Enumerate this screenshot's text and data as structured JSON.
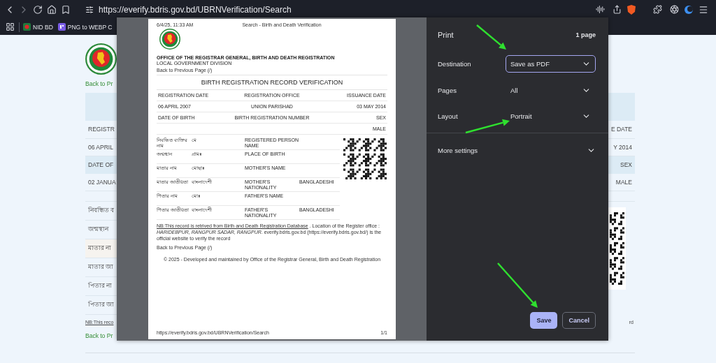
{
  "browser": {
    "url": "https://everify.bdris.gov.bd/UBRNVerification/Search",
    "bookmarks": [
      {
        "label": "NID BD",
        "kind": "nid"
      },
      {
        "label": "PNG to WEBP C",
        "kind": "png"
      }
    ]
  },
  "background_page": {
    "back_link": "Back to Pr",
    "table_rows": [
      {
        "kind": "band"
      },
      {
        "kind": "plain",
        "left": "REGISTR",
        "right": "E DATE"
      },
      {
        "kind": "plain",
        "left": "06 APRIL",
        "right": "Y 2014"
      },
      {
        "kind": "band",
        "left": "DATE OF",
        "right": "SEX"
      },
      {
        "kind": "plain",
        "left": "02 JANUA",
        "right": "MALE"
      }
    ],
    "person_rows": [
      {
        "kind": "plain",
        "label": "নিবন্ধিত ব"
      },
      {
        "kind": "plain",
        "label": "জন্মস্থান"
      },
      {
        "kind": "shade",
        "label": "মাতার না"
      },
      {
        "kind": "plain",
        "label": "মাতার জা"
      },
      {
        "kind": "plain",
        "label": "পিতার না"
      },
      {
        "kind": "plain",
        "label": "পিতার জা"
      }
    ],
    "note": "NB:This reco",
    "note_end": "rd",
    "bottom_back_link": "Back to Pr"
  },
  "print_preview": {
    "header_date": "6/4/25, 11:33 AM",
    "header_title": "Search - Birth and Death Verification",
    "office": "OFFICE OF THE REGISTRAR GENERAL, BIRTH AND DEATH REGISTRATION",
    "division": "LOCAL GOVERNMENT DIVISION",
    "back_link": "Back to Previous Page (/)",
    "title": "BIRTH REGISTRATION RECORD VERIFICATION",
    "info_rows": [
      {
        "left": "REGISTRATION DATE",
        "center": "REGISTRATION OFFICE",
        "right": "ISSUANCE DATE"
      },
      {
        "left": "06 APRIL 2007",
        "center": "UNION PARISHAD",
        "right": "03 MAY 2014"
      },
      {
        "left": "DATE OF BIRTH",
        "center": "BIRTH REGISTRATION NUMBER",
        "right": "SEX"
      },
      {
        "right": "MALE"
      }
    ],
    "person_rows": [
      {
        "bn_label": "নিবন্ধিত ব্যক্তির নাম",
        "bn_value": "মে",
        "en_label": "REGISTERED PERSON NAME"
      },
      {
        "bn_label": "জন্মস্থান",
        "bn_value": "গ্রামঃ",
        "en_label": "PLACE OF BIRTH"
      },
      {
        "bn_label": "মাতার নাম",
        "bn_value": "মোছাঃ",
        "en_label": "MOTHER'S NAME"
      },
      {
        "bn_label": "মাতার জাতীয়তা",
        "bn_value": "বাংলাদেশী",
        "en_label": "MOTHER'S NATIONALITY",
        "en_value": "BANGLADESHI"
      },
      {
        "bn_label": "পিতার নাম",
        "bn_value": "মোঃ",
        "en_label": "FATHER'S NAME"
      },
      {
        "bn_label": "পিতার জাতীয়তা",
        "bn_value": "বাংলাদেশী",
        "en_label": "FATHER'S NATIONALITY",
        "en_value": "BANGLADESHI"
      }
    ],
    "note_link": "NB:This record is retrived from Birth and Death Registration Database",
    "note_rest": " . Location of the Register office : *HARIDEBPUR, RANGPUR SADAR, RANGPUR*. everify.bdris.gov.bd (https://everify.bdris.gov.bd/) is the official website to verify the record",
    "back_link_bottom": "Back to Previous Page (/)",
    "footer": "© 2025 - Developed and maintained by Office of the Registrar General, Birth and Death Registration",
    "footer_url": "https://everify.bdris.gov.bd/UBRNVerification/Search",
    "page_number": "1/1"
  },
  "print_dialog": {
    "title": "Print",
    "page_count": "1 page",
    "settings": [
      {
        "label": "Destination",
        "value": "Save as PDF",
        "kind": "boxed"
      },
      {
        "label": "Pages",
        "value": "All",
        "kind": "plain"
      },
      {
        "label": "Layout",
        "value": "Portrait",
        "kind": "plain"
      }
    ],
    "more_settings": "More settings",
    "buttons": [
      {
        "label": "Save",
        "kind": "primary"
      },
      {
        "label": "Cancel",
        "kind": "secondary"
      }
    ]
  },
  "annotation_arrows": [
    {
      "kind": "arrow"
    },
    {
      "kind": "arrow"
    },
    {
      "kind": "arrow"
    }
  ]
}
